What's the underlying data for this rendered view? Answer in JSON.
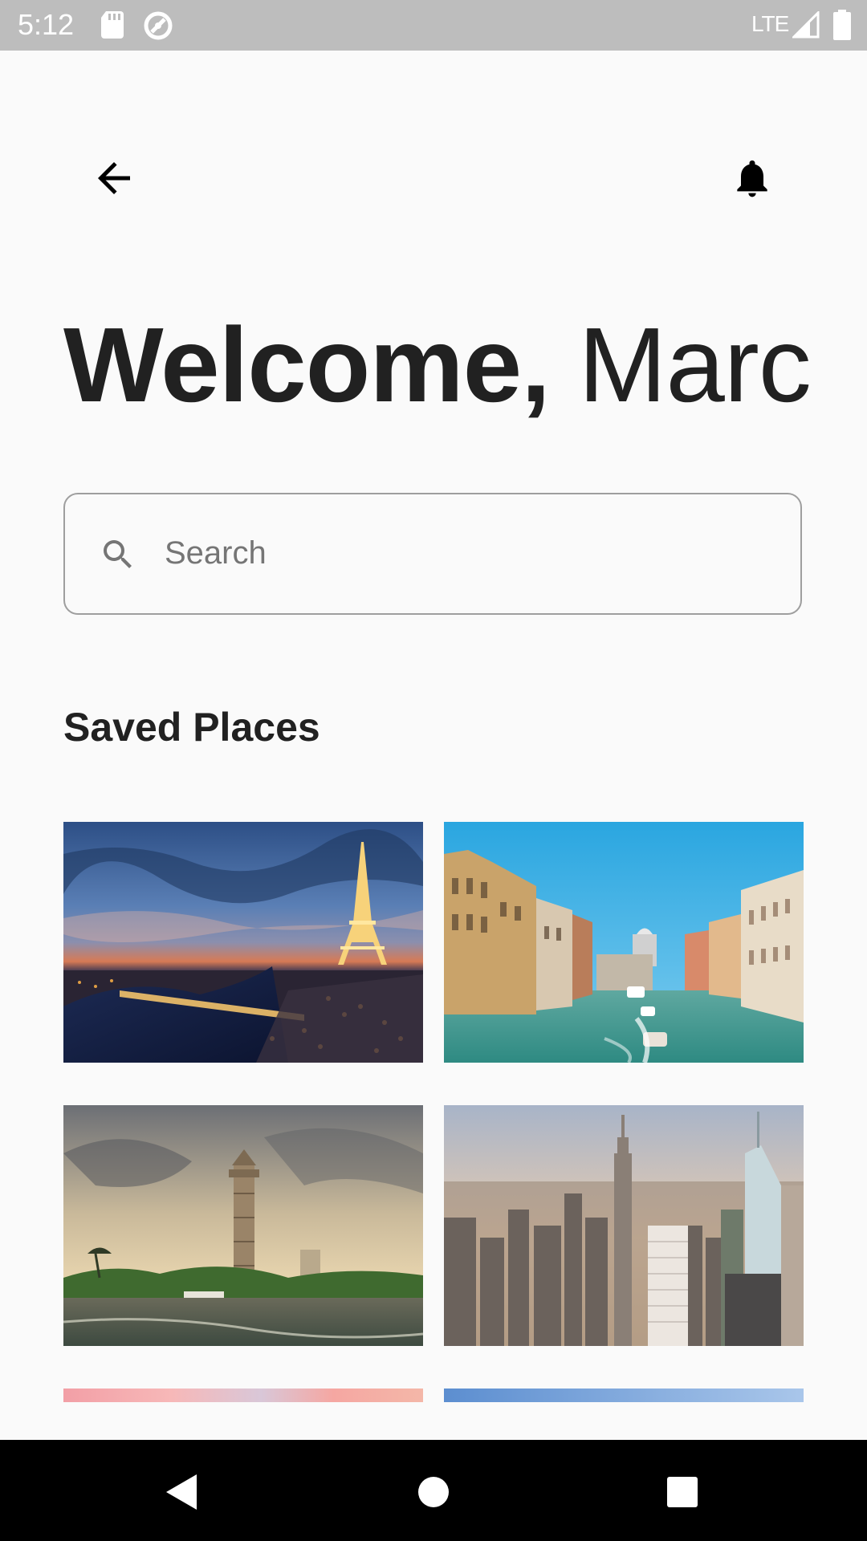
{
  "status_bar": {
    "time": "5:12",
    "network": "LTE",
    "icons": [
      "sd-card-icon",
      "sync-icon",
      "signal-icon",
      "battery-icon"
    ]
  },
  "app_bar": {
    "icons": [
      "back-arrow-icon",
      "bell-icon"
    ]
  },
  "welcome": {
    "greeting": "Welcome,",
    "name": "Marc"
  },
  "search": {
    "placeholder": "Search",
    "value": ""
  },
  "saved_places": {
    "title": "Saved Places",
    "items": [
      {
        "scene": "eiffel-tower-paris-night"
      },
      {
        "scene": "venice-grand-canal"
      },
      {
        "scene": "cairo-tower-nile"
      },
      {
        "scene": "new-york-skyline"
      },
      {
        "scene": "pink-sunset-sky"
      },
      {
        "scene": "blue-sky"
      }
    ]
  },
  "nav_bar": {
    "icons": [
      "nav-back-icon",
      "nav-home-icon",
      "nav-recents-icon"
    ]
  },
  "colors": {
    "background": "#fafafa",
    "status_bar": "#bdbdbd",
    "text_primary": "#212121",
    "search_border": "#9e9e9e",
    "nav_bar": "#000000"
  }
}
